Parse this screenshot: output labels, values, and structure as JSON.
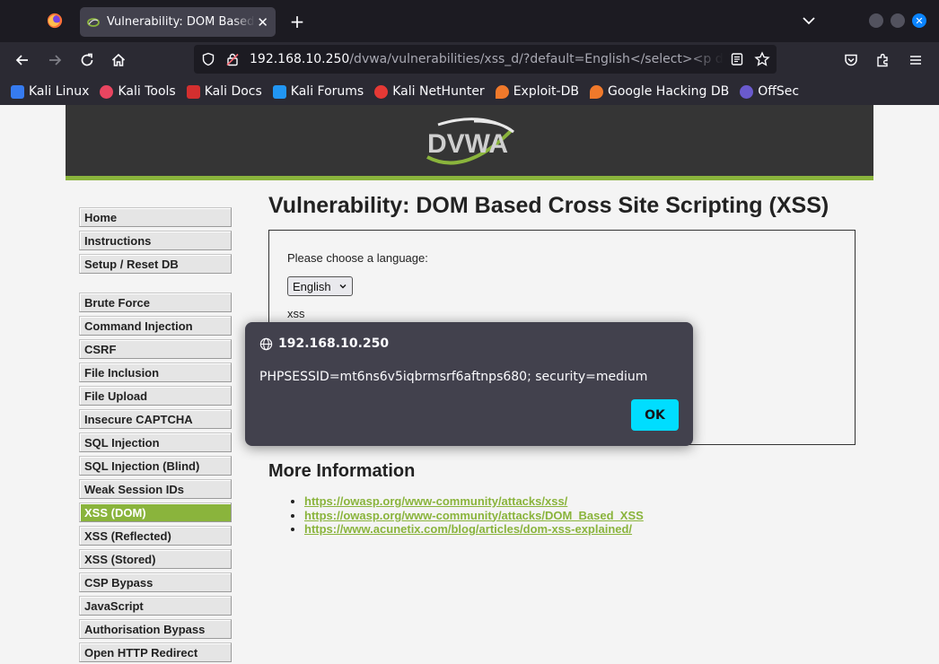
{
  "browser": {
    "tab_title": "Vulnerability: DOM Based Cross Site Scripting (XSS)",
    "url_host": "192.168.10.250",
    "url_path": "/dvwa/vulnerabilities/xss_d/?default=English</select><p dragg",
    "close_symbol": "✕",
    "new_tab_symbol": "+",
    "accent": "#0a84ff"
  },
  "bookmarks": [
    {
      "label": "Kali Linux",
      "color": "#367bf0"
    },
    {
      "label": "Kali Tools",
      "color": "#e94560"
    },
    {
      "label": "Kali Docs",
      "color": "#d32f2f"
    },
    {
      "label": "Kali Forums",
      "color": "#2196f3"
    },
    {
      "label": "Kali NetHunter",
      "color": "#e53935"
    },
    {
      "label": "Exploit-DB",
      "color": "#f0792b"
    },
    {
      "label": "Google Hacking DB",
      "color": "#f0792b"
    },
    {
      "label": "OffSec",
      "color": "#6a5acd"
    }
  ],
  "dvwa": {
    "logo_text": "DVWA",
    "accent": "#8ab43c",
    "menu_group1": [
      "Home",
      "Instructions",
      "Setup / Reset DB"
    ],
    "menu_group2": [
      "Brute Force",
      "Command Injection",
      "CSRF",
      "File Inclusion",
      "File Upload",
      "Insecure CAPTCHA",
      "SQL Injection",
      "SQL Injection (Blind)",
      "Weak Session IDs",
      "XSS (DOM)",
      "XSS (Reflected)",
      "XSS (Stored)",
      "CSP Bypass",
      "JavaScript",
      "Authorisation Bypass",
      "Open HTTP Redirect"
    ],
    "active_item": "XSS (DOM)",
    "page_title": "Vulnerability: DOM Based Cross Site Scripting (XSS)",
    "choose_label": "Please choose a language:",
    "select_value": "English",
    "injected_text": "xss",
    "more_info_title": "More Information",
    "links": [
      "https://owasp.org/www-community/attacks/xss/",
      "https://owasp.org/www-community/attacks/DOM_Based_XSS",
      "https://www.acunetix.com/blog/articles/dom-xss-explained/"
    ]
  },
  "dialog": {
    "origin": "192.168.10.250",
    "message": "PHPSESSID=mt6ns6v5iqbrmsrf6aftnps680; security=medium",
    "ok_label": "OK",
    "ok_color": "#00ddff"
  }
}
